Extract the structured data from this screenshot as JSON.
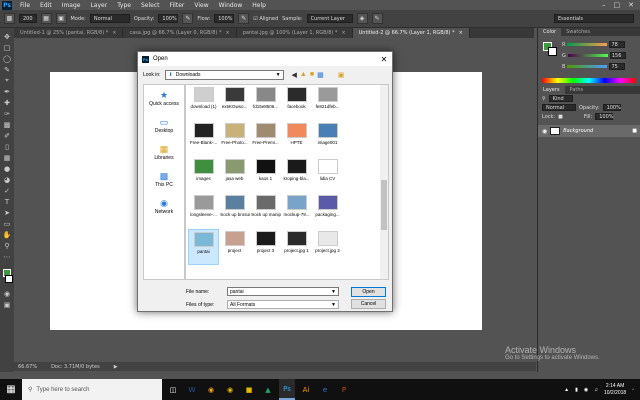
{
  "menubar": {
    "app_badge": "Ps",
    "items": [
      "File",
      "Edit",
      "Image",
      "Layer",
      "Type",
      "Select",
      "Filter",
      "View",
      "Window",
      "Help"
    ]
  },
  "options": {
    "brush_size": "200",
    "mode_label": "Mode:",
    "mode_value": "Normal",
    "opacity_label": "Opacity:",
    "opacity_value": "100%",
    "flow_label": "Flow:",
    "flow_value": "100%",
    "aligned_label": "Aligned",
    "sample_label": "Sample:",
    "sample_value": "Current Layer",
    "workspace": "Essentials"
  },
  "tabs": [
    {
      "label": "Untitled-1 @ 25% (pantai, RGB/8) *"
    },
    {
      "label": "casa.jpg @ 66.7% (Layer 0, RGB/8) *"
    },
    {
      "label": "pantai.jpg @ 100% (Layer 1, RGB/8) *"
    },
    {
      "label": "Untitled-2 @ 66.7% (Layer 1, RGB/8) *"
    }
  ],
  "status": {
    "zoom": "66.67%",
    "doc": "Doc: 3.71M/0 bytes"
  },
  "panels": {
    "color_tab": "Color",
    "swatches_tab": "Swatches",
    "r_label": "R",
    "r_value": "78",
    "g_label": "G",
    "g_value": "156",
    "b_label": "B",
    "b_value": "75",
    "fg_color": "#4e9c4b",
    "layers_tab": "Layers",
    "paths_tab": "Paths",
    "kind_label": "Kind",
    "blend_mode": "Normal",
    "opacity_label": "Opacity:",
    "opacity_value": "100%",
    "lock_label": "Lock:",
    "fill_label": "Fill:",
    "fill_value": "100%",
    "layer_name": "Background"
  },
  "dialog": {
    "title": "Open",
    "lookin_label": "Look in:",
    "lookin_value": "Downloads",
    "places": [
      {
        "label": "Quick access",
        "icon": "star-icon"
      },
      {
        "label": "Desktop",
        "icon": "desktop-icon"
      },
      {
        "label": "Libraries",
        "icon": "libraries-icon"
      },
      {
        "label": "This PC",
        "icon": "computer-icon"
      },
      {
        "label": "Network",
        "icon": "network-icon"
      }
    ],
    "files": [
      {
        "label": "download (1)",
        "color": "#cfcfcf"
      },
      {
        "label": "ex5KGwso...",
        "color": "#3a3a3a"
      },
      {
        "label": "fd15e8506...",
        "color": "#888888"
      },
      {
        "label": "facebook",
        "color": "#2b2b2b"
      },
      {
        "label": "fe821dfeb...",
        "color": "#9a9a9a"
      },
      {
        "label": "",
        "color": "#ffffff"
      },
      {
        "label": "Free-Blank-...",
        "color": "#222222"
      },
      {
        "label": "Free-Photo...",
        "color": "#c8b27a"
      },
      {
        "label": "Free-Premi...",
        "color": "#a08a70"
      },
      {
        "label": "HPTE",
        "color": "#f08a5d"
      },
      {
        "label": "image001",
        "color": "#4a7fb5"
      },
      {
        "label": "",
        "color": "#ffffff"
      },
      {
        "label": "images",
        "color": "#3f8f3f"
      },
      {
        "label": "jasa web",
        "color": "#8a9a70"
      },
      {
        "label": "kaos 1",
        "color": "#111111"
      },
      {
        "label": "kroping-bla...",
        "color": "#1a1a1a"
      },
      {
        "label": "lidia CV",
        "color": "#ffffff"
      },
      {
        "label": "",
        "color": "#ffffff"
      },
      {
        "label": "longsleeve-...",
        "color": "#9a9a9a"
      },
      {
        "label": "mock up brosur",
        "color": "#5b7f9f"
      },
      {
        "label": "mock up manipulasi",
        "color": "#6a6a6a"
      },
      {
        "label": "mockup-79...",
        "color": "#7aa3c8"
      },
      {
        "label": "packaging...",
        "color": "#5a5aa8"
      },
      {
        "label": "",
        "color": "#ffffff"
      },
      {
        "label": "pantai",
        "color": "#7ab8d8",
        "selected": true
      },
      {
        "label": "project",
        "color": "#c8a090"
      },
      {
        "label": "project 3",
        "color": "#1a1a1a"
      },
      {
        "label": "project.jpg 1",
        "color": "#2a2a2a"
      },
      {
        "label": "project.jpg 2",
        "color": "#e8e8e8"
      },
      {
        "label": "",
        "color": "#ffffff"
      }
    ],
    "filename_label": "File name:",
    "filename_value": "pantai",
    "filetype_label": "Files of type:",
    "filetype_value": "All Formats",
    "open_label": "Open",
    "cancel_label": "Cancel"
  },
  "watermark": {
    "title": "Activate Windows",
    "sub": "Go to Settings to activate Windows."
  },
  "taskbar": {
    "search_placeholder": "Type here to search",
    "time": "2:14 AM",
    "date": "10/2/2018"
  }
}
